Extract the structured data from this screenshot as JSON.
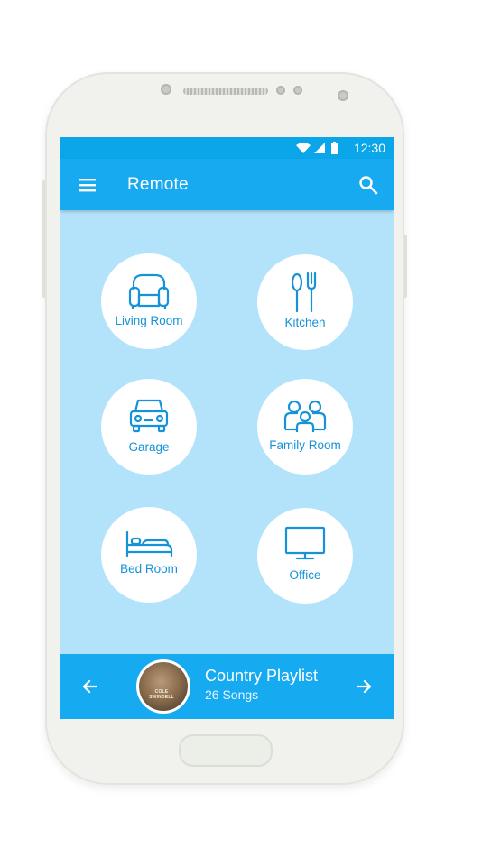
{
  "status_bar": {
    "time": "12:30",
    "icons": [
      "wifi-icon",
      "cell-signal-icon",
      "battery-icon"
    ]
  },
  "app_bar": {
    "title": "Remote",
    "menu_icon": "menu-icon",
    "search_icon": "search-icon"
  },
  "rooms": [
    {
      "label": "Living Room",
      "icon": "sofa-icon"
    },
    {
      "label": "Kitchen",
      "icon": "fork-spoon-icon"
    },
    {
      "label": "Garage",
      "icon": "car-icon"
    },
    {
      "label": "Family Room",
      "icon": "family-icon"
    },
    {
      "label": "Bed Room",
      "icon": "bed-icon"
    },
    {
      "label": "Office",
      "icon": "monitor-icon"
    }
  ],
  "player": {
    "title": "Country Playlist",
    "subtitle": "26 Songs",
    "album_text": "COLE SWINDELL",
    "prev_icon": "arrow-left-icon",
    "next_icon": "arrow-right-icon"
  },
  "colors": {
    "primary": "#18aaf0",
    "status_bar": "#0aa6e9",
    "background": "#b3e3fa",
    "accent_text": "#1592d8"
  }
}
